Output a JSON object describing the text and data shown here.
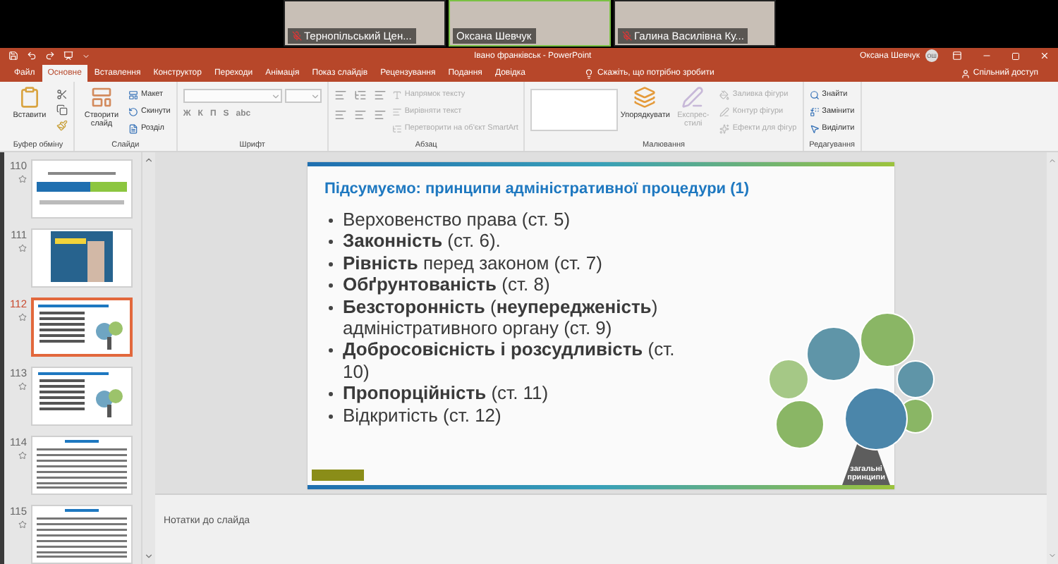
{
  "video_tiles": [
    {
      "name": "Тернопільський Цен...",
      "muted": true,
      "selected": false
    },
    {
      "name": "Оксана Шевчук",
      "muted": false,
      "selected": true
    },
    {
      "name": "Галина Василівна Ку...",
      "muted": true,
      "selected": false
    }
  ],
  "window": {
    "title": "Івано франківськ - PowerPoint",
    "user": "Оксана Шевчук",
    "avatar": "ОШ"
  },
  "tabs": [
    {
      "label": "Файл",
      "selected": false
    },
    {
      "label": "Основне",
      "selected": true
    },
    {
      "label": "Вставлення",
      "selected": false
    },
    {
      "label": "Конструктор",
      "selected": false
    },
    {
      "label": "Переходи",
      "selected": false
    },
    {
      "label": "Анімація",
      "selected": false
    },
    {
      "label": "Показ слайдів",
      "selected": false
    },
    {
      "label": "Рецензування",
      "selected": false
    },
    {
      "label": "Подання",
      "selected": false
    },
    {
      "label": "Довідка",
      "selected": false
    }
  ],
  "tell_me": "Скажіть, що потрібно зробити",
  "share": "Спільний доступ",
  "ribbon_groups": [
    {
      "label": "Буфер обміну",
      "items": [
        {
          "kind": "large",
          "label": "Вставити",
          "disabled": false
        },
        {
          "kind": "tools"
        }
      ]
    },
    {
      "label": "Слайди",
      "items": [
        {
          "kind": "large",
          "label": "Створити слайд",
          "disabled": false
        },
        {
          "kind": "stack",
          "entries": [
            {
              "label": "Макет",
              "disabled": false
            },
            {
              "label": "Скинути",
              "disabled": false
            },
            {
              "label": "Розділ",
              "disabled": false
            }
          ]
        }
      ]
    },
    {
      "label": "Шрифт",
      "items": [
        {
          "kind": "font",
          "glyphs": [
            "Ж",
            "К",
            "П",
            "S",
            "abc"
          ]
        }
      ]
    },
    {
      "label": "Абзац",
      "items": [
        {
          "kind": "paragraph"
        },
        {
          "kind": "stack",
          "entries": [
            {
              "label": "Напрямок тексту",
              "disabled": true
            },
            {
              "label": "Вирівняти текст",
              "disabled": true
            },
            {
              "label": "Перетворити на об'єкт SmartArt",
              "disabled": true
            }
          ]
        }
      ]
    },
    {
      "label": "Малювання",
      "items": [
        {
          "kind": "shapes"
        },
        {
          "kind": "large",
          "label": "Упорядкувати",
          "disabled": false
        },
        {
          "kind": "large",
          "label": "Експрес-стилі",
          "disabled": true
        },
        {
          "kind": "stack",
          "entries": [
            {
              "label": "Заливка фігури",
              "disabled": true
            },
            {
              "label": "Контур фігури",
              "disabled": true
            },
            {
              "label": "Ефекти для фігур",
              "disabled": true
            }
          ]
        }
      ]
    },
    {
      "label": "Редагування",
      "items": [
        {
          "kind": "stack",
          "entries": [
            {
              "label": "Знайти",
              "disabled": false
            },
            {
              "label": "Замінити",
              "disabled": false
            },
            {
              "label": "Виділити",
              "disabled": false
            }
          ]
        }
      ]
    }
  ],
  "thumbnails": [
    {
      "number": "110",
      "kind": "title",
      "selected": false
    },
    {
      "number": "111",
      "kind": "photo",
      "selected": false
    },
    {
      "number": "112",
      "kind": "bullets",
      "selected": true
    },
    {
      "number": "113",
      "kind": "bullets",
      "selected": false
    },
    {
      "number": "114",
      "kind": "text",
      "selected": false
    },
    {
      "number": "115",
      "kind": "text",
      "selected": false
    }
  ],
  "slide": {
    "title": "Підсумуємо: принципи адміністративної процедури (1)",
    "bullets": [
      "Верховенство права (ст. 5)",
      "**Законність** (ст. 6).",
      "**Рівність** перед законом (ст. 7)",
      "**Обґрунтованість** (ст. 8)",
      "**Безсторонність** (**неупередженість**) адміністративного органу (ст. 9)",
      "**Добросовісність і розсудливість** (ст. 10)",
      "**Пропорційність** (ст. 11)",
      "Відкритість (ст. 12)"
    ],
    "tree_label": "загальні принципи"
  },
  "notes_placeholder": "Нотатки до слайда"
}
